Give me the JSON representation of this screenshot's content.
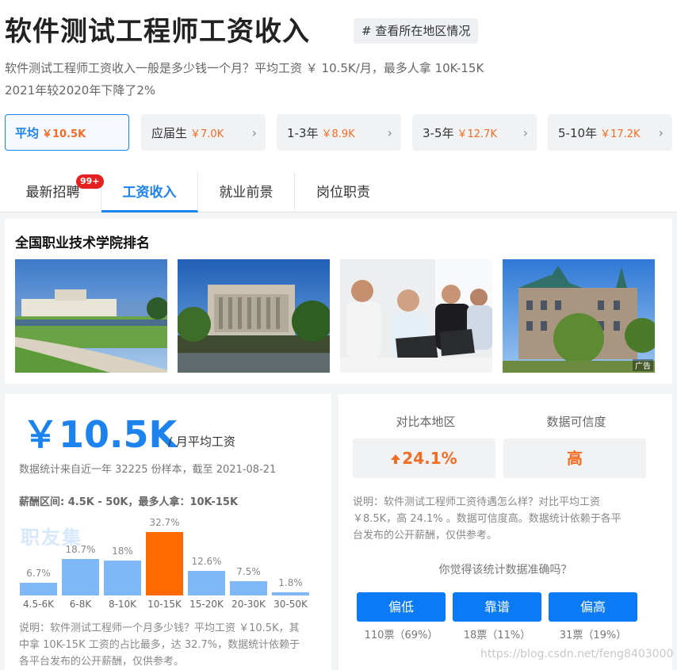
{
  "header": {
    "title": "软件测试工程师工资收入",
    "region_tag": "# 查看所在地区情况",
    "summary_line1": "软件测试工程师工资收入一般是多少钱一个月？平均工资 ￥ 10.5K/月，最多人拿 10K-15K",
    "summary_line2": "2021年较2020年下降了2%"
  },
  "experience_tabs": [
    {
      "label": "平均",
      "value": "￥10.5K",
      "active": true
    },
    {
      "label": "应届生",
      "value": "￥7.0K"
    },
    {
      "label": "1-3年",
      "value": "￥8.9K"
    },
    {
      "label": "3-5年",
      "value": "￥12.7K"
    },
    {
      "label": "5-10年",
      "value": "￥17.2K"
    }
  ],
  "chevron": "›",
  "nav_tabs": [
    {
      "label": "最新招聘"
    },
    {
      "label": "工资收入",
      "active": true
    },
    {
      "label": "就业前景"
    },
    {
      "label": "岗位职责"
    }
  ],
  "badge": "99+",
  "schools": {
    "title": "全国职业技术学院排名",
    "ad_tag": "广告"
  },
  "salary": {
    "amount": "￥10.5K",
    "unit": "/ 月平均工资",
    "stat_note": "数据统计来自近一年 32225 份样本，截至 2021-08-21",
    "range_note": "薪酬区间: 4.5K - 50K，最多人拿：10K-15K",
    "logo": "职友集",
    "explain_line1": "说明：软件测试工程师一个月多少钱？平均工资 ￥10.5K，其",
    "explain_line2": "中拿 10K-15K 工资的占比最多，达 32.7%，数据统计依赖于",
    "explain_line3": "各平台发布的公开薪酬，仅供参考。"
  },
  "chart_data": {
    "type": "bar",
    "categories": [
      "4.5-6K",
      "6-8K",
      "8-10K",
      "10-15K",
      "15-20K",
      "20-30K",
      "30-50K"
    ],
    "values": [
      6.7,
      18.7,
      18,
      32.7,
      12.6,
      7.5,
      1.8
    ],
    "labels": [
      "6.7%",
      "18.7%",
      "18%",
      "32.7%",
      "12.6%",
      "7.5%",
      "1.8%"
    ],
    "highlight_index": 3,
    "colors": {
      "normal": "#7fb8f7",
      "highlight": "#ff6a00"
    }
  },
  "compare": {
    "head_left": "对比本地区",
    "head_right": "数据可信度",
    "value_left": "24.1%",
    "value_right": "高",
    "explain_line1": "说明：软件测试工程师工资待遇怎么样？对比平均工资",
    "explain_line2": "￥8.5K，高 24.1% 。数据可信度高。数据统计依赖于各平",
    "explain_line3": "台发布的公开薪酬，仅供参考。",
    "question": "你觉得该统计数据准确吗？",
    "votes": [
      {
        "label": "偏低",
        "count": "110票（69%）"
      },
      {
        "label": "靠谱",
        "count": "18票（11%）"
      },
      {
        "label": "偏高",
        "count": "31票（19%）"
      }
    ]
  },
  "watermark": "https://blog.csdn.net/feng8403000",
  "colors": {
    "accent": "#1b82ee",
    "orange": "#f26c22",
    "button": "#0a7bf5"
  }
}
